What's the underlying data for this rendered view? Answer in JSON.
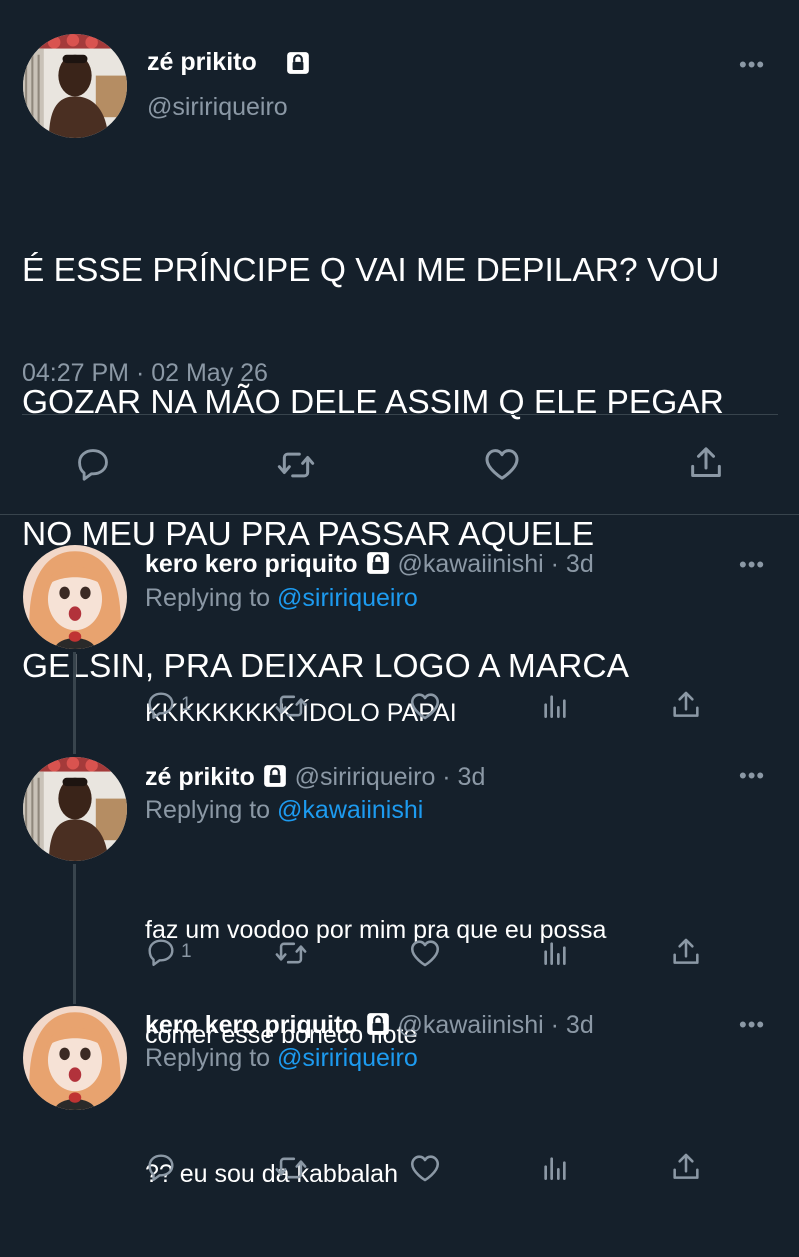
{
  "main_tweet": {
    "author_name": "zé prikito",
    "handle": "@siririqueiro",
    "text_lines": [
      "É ESSE PRÍNCIPE Q VAI ME DEPILAR? VOU",
      "GOZAR NA MÃO DELE ASSIM Q ELE PEGAR",
      "NO MEU PAU PRA PASSAR AQUELE",
      "GELSIN, PRA DEIXAR LOGO A MARCA"
    ],
    "timestamp": "04:27 PM · 02 May 26",
    "more": "•••"
  },
  "replies": [
    {
      "author_name": "kero kero priquito",
      "meta": "@kawaiinishi · 3d",
      "replying_prefix": "Replying to ",
      "replying_to": "@siririqueiro",
      "text_lines": [
        "KKKKKKKKK ÍDOLO PAPAI"
      ],
      "reply_count": "1",
      "more": "•••"
    },
    {
      "author_name": "zé prikito",
      "meta": "@siririqueiro · 3d",
      "replying_prefix": "Replying to ",
      "replying_to": "@kawaiinishi",
      "text_lines": [
        "faz um voodoo por mim pra que eu possa",
        "comer esse boneco fiote"
      ],
      "reply_count": "1",
      "more": "•••"
    },
    {
      "author_name": "kero kero priquito",
      "meta": "@kawaiinishi · 3d",
      "replying_prefix": "Replying to ",
      "replying_to": "@siririqueiro",
      "text_lines": [
        "?? eu sou da kabbalah"
      ],
      "reply_count": "",
      "more": "•••"
    }
  ],
  "colors": {
    "background": "#15202b",
    "text": "#ffffff",
    "secondary": "#8b98a5",
    "link": "#1d9bf0",
    "divider": "#38444d"
  },
  "icons": [
    "reply-icon",
    "retweet-icon",
    "like-icon",
    "share-icon",
    "analytics-icon",
    "lock-icon",
    "more-icon"
  ]
}
